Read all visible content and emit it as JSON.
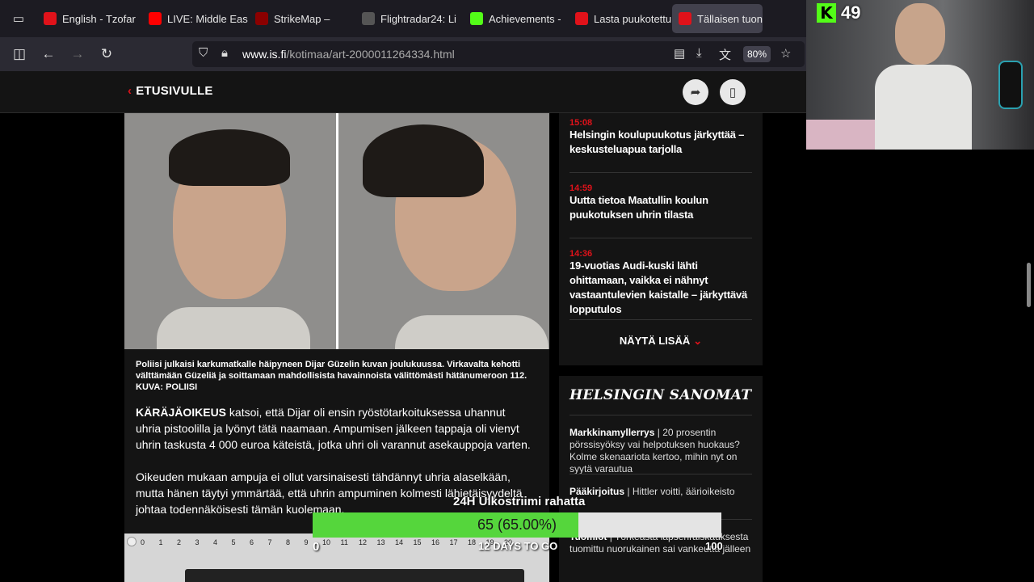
{
  "tabs": [
    {
      "label": "English - Tzofar",
      "icon": "red-alert-icon",
      "color": "#e0121a"
    },
    {
      "label": "LIVE: Middle Eas",
      "icon": "youtube-icon",
      "color": "#ff0000"
    },
    {
      "label": "StrikeMap –",
      "icon": "muted-speaker-icon",
      "color": "#8b0000"
    },
    {
      "label": "Flightradar24: Li",
      "icon": "radar-icon",
      "color": "#555555"
    },
    {
      "label": "Achievements -",
      "icon": "kick-icon",
      "color": "#53fc18"
    },
    {
      "label": "Lasta puukotettu",
      "icon": "il-icon",
      "color": "#e0121a"
    },
    {
      "label": "Tällaisen tuon",
      "icon": "is-icon",
      "color": "#e0121a",
      "active": true
    }
  ],
  "nav": {
    "url_domain": "www.is.fi",
    "url_path": "/kotimaa/art-2000011264334.html",
    "zoom": "80%"
  },
  "site": {
    "back_label": "ETUSIVULLE"
  },
  "article": {
    "caption": "Poliisi julkaisi karkumatkalle häipyneen Dijar Güzelin kuvan joulukuussa. Virkavalta kehotti välttämään Güzeliä ja soittamaan mahdollisista havainnoista välittömästi hätänumeroon 112.",
    "photo_credit": "KUVA: POLIISI",
    "para1_lead": "KÄRÄJÄOIKEUS",
    "para1_rest": " katsoi, että Dijar oli ensin ryöstötarkoituksessa uhannut uhria pistoolilla ja lyönyt tätä naamaan. Ampumisen jälkeen tappaja oli vienyt uhrin taskusta 4 000 euroa käteistä, jotka uhri oli varannut asekauppoja varten.",
    "para2": "Oikeuden mukaan ampuja ei ollut varsinaisesti tähdännyt uhria alaselkään, mutta hänen täytyi ymmärtää, että uhrin ampuminen kolmesti lähietäisyydeltä johtaa todennäköisesti tämän kuolemaan.",
    "ruler_scale": [
      "0",
      "1",
      "2",
      "3",
      "4",
      "5",
      "6",
      "7",
      "8",
      "9",
      "10",
      "11",
      "12",
      "13",
      "14",
      "15",
      "16",
      "17",
      "18",
      "19",
      "20"
    ]
  },
  "sidebar": {
    "news": [
      {
        "time": "15:08",
        "title": "Helsingin koulupuukotus järkyttää – keskusteluapua tarjolla"
      },
      {
        "time": "14:59",
        "title": "Uutta tietoa Maatullin koulun puukotuksen uhrin tilasta"
      },
      {
        "time": "14:36",
        "title": "19-vuotias Audi-kuski lähti ohittamaan, vaikka ei nähnyt vastaantulevien kaistalle – järkyttävä lopputulos"
      }
    ],
    "more_label": "NÄYTÄ LISÄÄ",
    "hs_title": "HELSINGIN SANOMAT",
    "hs_items": [
      {
        "section": "Markkinamyllerrys",
        "text": "20 prosentin pörssisyöksy vai helpotuksen huokaus? Kolme skenaariota kertoo, mihin nyt on syytä varautua"
      },
      {
        "section": "Pääkirjoitus",
        "text": "Hittler voitti, äärioikeisto"
      },
      {
        "section": "Tuomiot",
        "text": "Törkeästä lapsenraiskauksesta tuomittu nuorukainen sai vankeutta jälleen"
      }
    ]
  },
  "stream": {
    "kick_count": "49",
    "goal_label": "24H Ulkostriimi rahatta",
    "progress_text": "65 (65.00%)",
    "progress_value": 65,
    "progress_max": 100,
    "progress_fraction": 0.65,
    "min_label": "0",
    "max_label": "100",
    "sub_label": "12 DAYS TO GO",
    "accent": "#55d63c"
  }
}
